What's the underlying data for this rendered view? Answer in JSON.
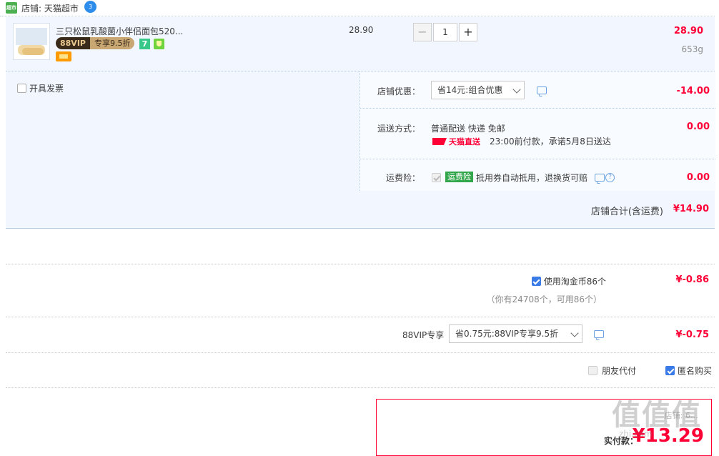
{
  "shop": {
    "tag": "超市",
    "label": "店铺: 天猫超市",
    "ww_badge": "3"
  },
  "item": {
    "title": "三只松鼠乳酸菌小伴侣面包520...",
    "vip_label": "88VIP",
    "vip_discount": "专享9.5折",
    "badge_seven": "7",
    "unit_price": "28.90",
    "quantity": "1",
    "line_total": "28.90",
    "weight": "653g"
  },
  "invoice": {
    "label": "开具发票"
  },
  "promo": {
    "label": "店铺优惠：",
    "selected": "省14元:组合优惠",
    "amount": "-14.00"
  },
  "shipping": {
    "label": "运送方式：",
    "method": "普通配送 快递 免邮",
    "tmall_logo": "天猫直送",
    "promise": "23:00前付款，承诺5月8日送达",
    "amount": "0.00"
  },
  "insurance": {
    "label": "运费险：",
    "tag": "运费险",
    "desc": "抵用券自动抵用，退换货可赔",
    "amount": "0.00"
  },
  "shop_total": {
    "label": "店铺合计(含运费)",
    "value": "¥14.90"
  },
  "coins": {
    "label": "使用淘金币86个",
    "note": "（你有24708个，可用86个）",
    "amount": "¥-0.86"
  },
  "vip": {
    "label": "88VIP专享",
    "selected": "省0.75元:88VIP专享9.5折",
    "amount": "¥-0.75"
  },
  "friend_pay": {
    "label": "朋友代付"
  },
  "anonymous": {
    "label": "匿名购买"
  },
  "payment": {
    "sub_label": "店铺: 6…",
    "label": "实付款：",
    "value": "¥13.29"
  },
  "watermark": {
    "main": "值值值",
    "sub": "zhi.com"
  },
  "colors": {
    "accent_red": "#ff0036",
    "panel_blue": "#f2f7ff",
    "check_blue": "#3b7be8"
  }
}
